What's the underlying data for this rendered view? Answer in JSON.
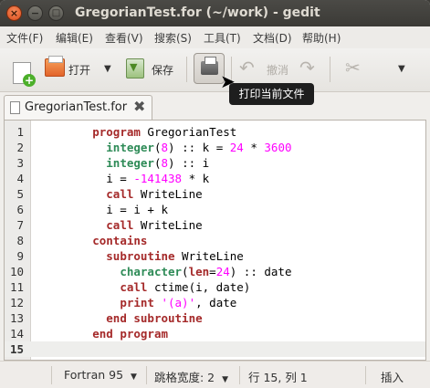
{
  "window": {
    "title": "GregorianTest.for (~/work) - gedit"
  },
  "title_controls": {
    "close": "×",
    "minimize": "−",
    "maximize": "□"
  },
  "menu": [
    "文件(F)",
    "编辑(E)",
    "查看(V)",
    "搜索(S)",
    "工具(T)",
    "文档(D)",
    "帮助(H)"
  ],
  "toolbar": {
    "open_label": "打开",
    "dropdown": "▼",
    "save_label": "保存",
    "undo_label": "撤消",
    "more": "▼"
  },
  "tooltip": "打印当前文件",
  "tab": {
    "label": "GregorianTest.for",
    "close": "✖"
  },
  "editor": {
    "current_line": 15,
    "lines": [
      {
        "n": "1",
        "segs": [
          [
            "        ",
            ""
          ],
          [
            "program",
            "kw"
          ],
          [
            " GregorianTest",
            ""
          ]
        ]
      },
      {
        "n": "2",
        "segs": [
          [
            "          ",
            ""
          ],
          [
            "integer",
            "ty"
          ],
          [
            "(",
            ""
          ],
          [
            "8",
            "num"
          ],
          [
            ") :: k = ",
            ""
          ],
          [
            "24",
            "num"
          ],
          [
            " * ",
            ""
          ],
          [
            "3600",
            "num"
          ]
        ]
      },
      {
        "n": "3",
        "segs": [
          [
            "          ",
            ""
          ],
          [
            "integer",
            "ty"
          ],
          [
            "(",
            ""
          ],
          [
            "8",
            "num"
          ],
          [
            ") :: i",
            ""
          ]
        ]
      },
      {
        "n": "4",
        "segs": [
          [
            "          i = ",
            ""
          ],
          [
            "-141438",
            "num"
          ],
          [
            " * k",
            ""
          ]
        ]
      },
      {
        "n": "5",
        "segs": [
          [
            "          ",
            ""
          ],
          [
            "call",
            "kw"
          ],
          [
            " WriteLine",
            ""
          ]
        ]
      },
      {
        "n": "6",
        "segs": [
          [
            "          i = i + k",
            ""
          ]
        ]
      },
      {
        "n": "7",
        "segs": [
          [
            "          ",
            ""
          ],
          [
            "call",
            "kw"
          ],
          [
            " WriteLine",
            ""
          ]
        ]
      },
      {
        "n": "8",
        "segs": [
          [
            "        ",
            ""
          ],
          [
            "contains",
            "kw"
          ]
        ]
      },
      {
        "n": "9",
        "segs": [
          [
            "          ",
            ""
          ],
          [
            "subroutine",
            "kw"
          ],
          [
            " WriteLine",
            ""
          ]
        ]
      },
      {
        "n": "10",
        "segs": [
          [
            "            ",
            ""
          ],
          [
            "character",
            "ty"
          ],
          [
            "(",
            ""
          ],
          [
            "len",
            "kw"
          ],
          [
            "=",
            ""
          ],
          [
            "24",
            "num"
          ],
          [
            ") :: date",
            ""
          ]
        ]
      },
      {
        "n": "11",
        "segs": [
          [
            "            ",
            ""
          ],
          [
            "call",
            "kw"
          ],
          [
            " ctime(i, date)",
            ""
          ]
        ]
      },
      {
        "n": "12",
        "segs": [
          [
            "            ",
            ""
          ],
          [
            "print",
            "kw"
          ],
          [
            " ",
            ""
          ],
          [
            "'(a)'",
            "str"
          ],
          [
            ", date",
            ""
          ]
        ]
      },
      {
        "n": "13",
        "segs": [
          [
            "          ",
            ""
          ],
          [
            "end subroutine",
            "kw"
          ]
        ]
      },
      {
        "n": "14",
        "segs": [
          [
            "        ",
            ""
          ],
          [
            "end program",
            "kw"
          ]
        ]
      },
      {
        "n": "15",
        "segs": []
      }
    ]
  },
  "status": {
    "language": "Fortran 95",
    "tab_width": "跳格宽度: 2",
    "position": "行 15, 列 1",
    "mode": "插入",
    "dropdown": "▼"
  }
}
